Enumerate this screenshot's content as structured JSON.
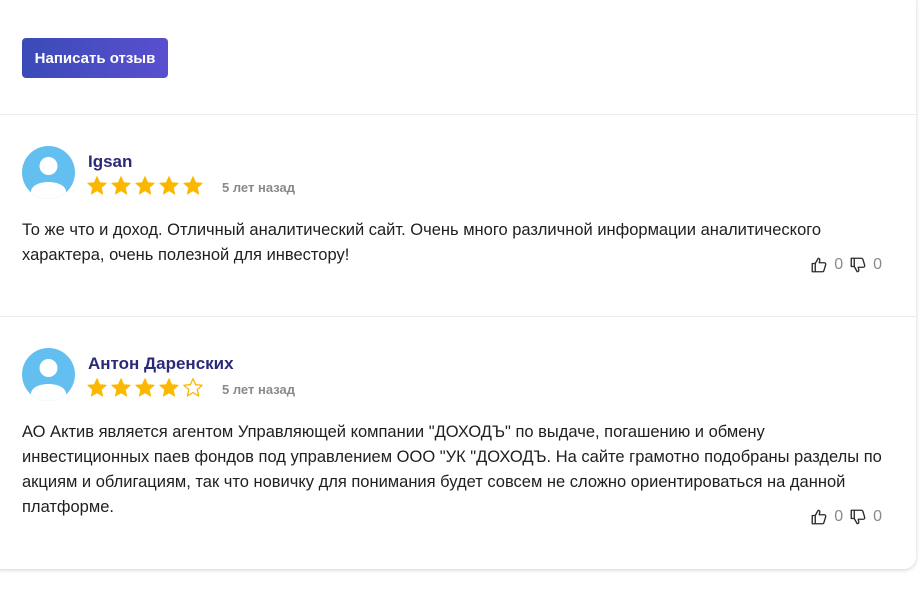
{
  "actions": {
    "write_review_label": "Написать отзыв"
  },
  "reviews": [
    {
      "author": "Igsan",
      "rating": 5,
      "max_rating": 5,
      "date": "5 лет назад",
      "text": "То же что и доход. Отличный аналитический сайт. Очень много различной информации аналитического характера, очень полезной для инвестору!",
      "likes": "0",
      "dislikes": "0"
    },
    {
      "author": "Антон Даренских",
      "rating": 4,
      "max_rating": 5,
      "date": "5 лет назад",
      "text": "АО Актив является агентом Управляющей компании \"ДОХОДЪ\" по выдаче, погашению и обмену инвестиционных паев фондов под управлением ООО \"УК \"ДОХОДЪ. На сайте грамотно подобраны разделы по акциям и облигациям, так что новичку для понимания будет совсем не сложно ориентироваться на данной платформе.",
      "likes": "0",
      "dislikes": "0"
    }
  ],
  "colors": {
    "star_filled": "#fcb800",
    "star_empty": "#fcb800",
    "author": "#2b2a7a",
    "avatar_bg": "#63bff0",
    "button_bg": "#4a4bc0"
  },
  "icons": {
    "avatar": "user-silhouette-icon",
    "like": "thumbs-up-icon",
    "dislike": "thumbs-down-icon",
    "star": "star-icon"
  }
}
